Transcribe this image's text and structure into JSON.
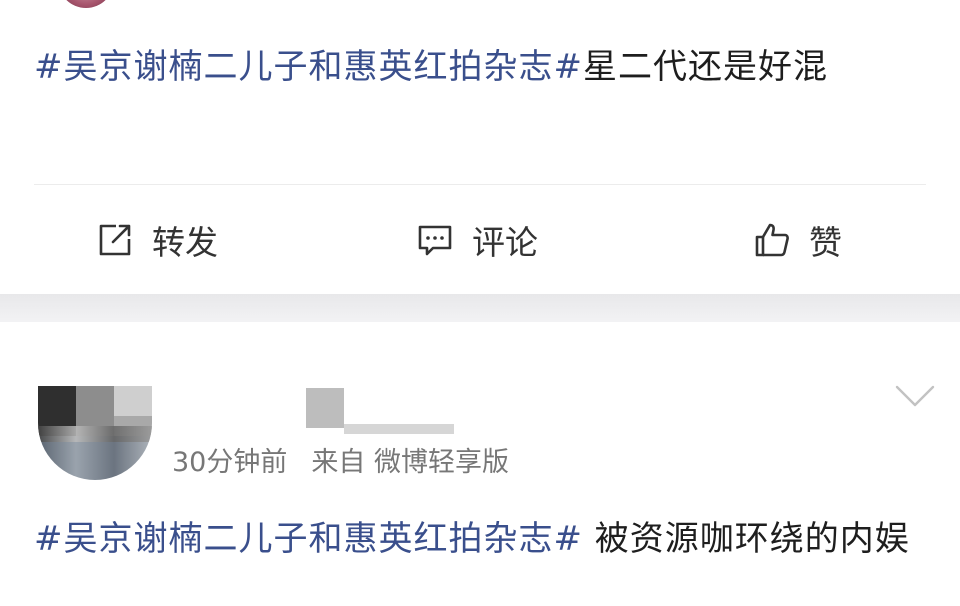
{
  "post1": {
    "hashtag": "#吴京谢楠二儿子和惠英红拍杂志#",
    "text": "星二代还是好混",
    "actions": {
      "repost": "转发",
      "comment": "评论",
      "like": "赞"
    }
  },
  "post2": {
    "time": "30分钟前",
    "source": "来自 微博轻享版",
    "hashtag": "#吴京谢楠二儿子和惠英红拍杂志#",
    "text": " 被资源咖环绕的内娱"
  },
  "colors": {
    "hashtag": "#3a4f8c",
    "separator": "#e8e8ea"
  },
  "icons": [
    "repost-icon",
    "comment-icon",
    "like-icon",
    "chevron-down-icon"
  ]
}
